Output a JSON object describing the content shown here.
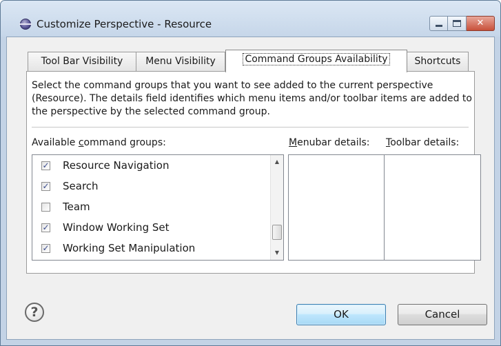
{
  "window": {
    "title": "Customize Perspective - Resource",
    "close_glyph": "✕"
  },
  "tabs": [
    {
      "label": "Tool Bar Visibility",
      "active": false
    },
    {
      "label": "Menu Visibility",
      "active": false
    },
    {
      "label": "Command Groups Availability",
      "active": true
    },
    {
      "label": "Shortcuts",
      "active": false
    }
  ],
  "panel": {
    "description": "Select the command groups that you want to see added to the current perspective (Resource).  The details field identifies which menu items and/or toolbar items are added to the perspective by the selected command group.",
    "available_label_pre": "Available ",
    "available_label_mnemonic": "c",
    "available_label_post": "ommand groups:",
    "menubar_label_mnemonic": "M",
    "menubar_label_post": "enubar details:",
    "toolbar_label_mnemonic": "T",
    "toolbar_label_post": "oolbar details:",
    "command_groups": [
      {
        "label": "Resource Navigation",
        "checked": true
      },
      {
        "label": "Search",
        "checked": true
      },
      {
        "label": "Team",
        "checked": false
      },
      {
        "label": "Window Working Set",
        "checked": true
      },
      {
        "label": "Working Set Manipulation",
        "checked": true
      }
    ],
    "check_glyph": "✓",
    "scroll_up_glyph": "▲",
    "scroll_down_glyph": "▼"
  },
  "footer": {
    "help_glyph": "?",
    "ok_label": "OK",
    "cancel_label": "Cancel"
  }
}
